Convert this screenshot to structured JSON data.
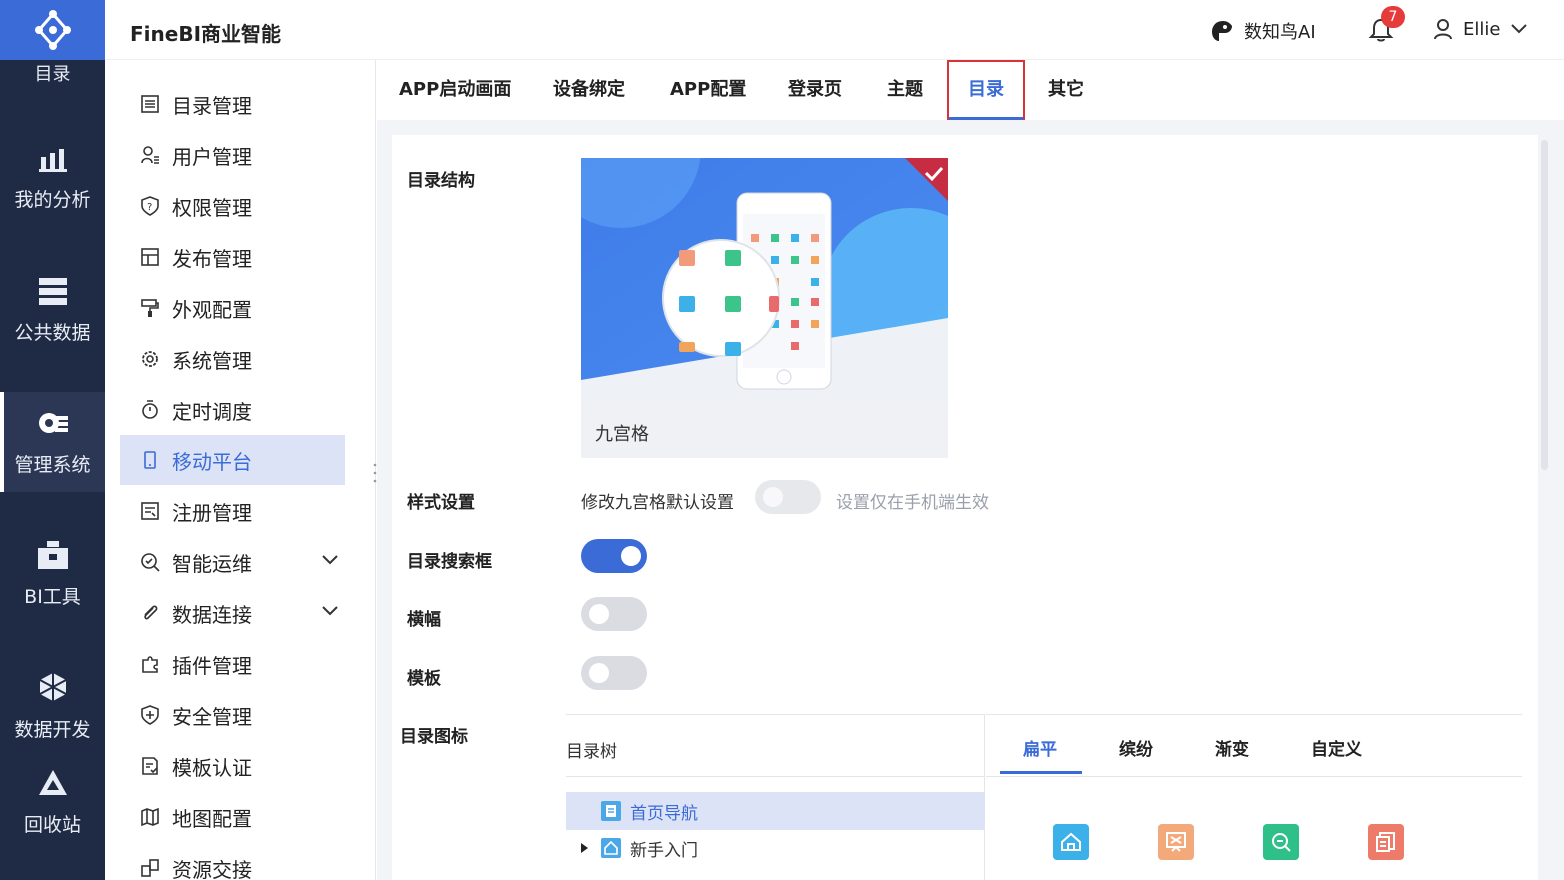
{
  "rail": {
    "top_label": "目录",
    "items": [
      {
        "label": "我的分析",
        "icon": "chart-icon"
      },
      {
        "label": "公共数据",
        "icon": "database-icon"
      },
      {
        "label": "管理系统",
        "icon": "gear-list-icon"
      },
      {
        "label": "BI工具",
        "icon": "toolbox-icon"
      },
      {
        "label": "数据开发",
        "icon": "cube-icon"
      },
      {
        "label": "回收站",
        "icon": "recycle-icon"
      }
    ]
  },
  "header": {
    "brand": "FineBI商业智能",
    "ai_label": "数知鸟AI",
    "notification_count": "7",
    "user_name": "Ellie"
  },
  "subnav": {
    "items": [
      {
        "label": "目录管理"
      },
      {
        "label": "用户管理"
      },
      {
        "label": "权限管理"
      },
      {
        "label": "发布管理"
      },
      {
        "label": "外观配置"
      },
      {
        "label": "系统管理"
      },
      {
        "label": "定时调度"
      },
      {
        "label": "移动平台"
      },
      {
        "label": "注册管理"
      },
      {
        "label": "智能运维"
      },
      {
        "label": "数据连接"
      },
      {
        "label": "插件管理"
      },
      {
        "label": "安全管理"
      },
      {
        "label": "模板认证"
      },
      {
        "label": "地图配置"
      },
      {
        "label": "资源交接"
      }
    ]
  },
  "tabs": [
    "APP启动画面",
    "设备绑定",
    "APP配置",
    "登录页",
    "主题",
    "目录",
    "其它"
  ],
  "form": {
    "structure_label": "目录结构",
    "card_caption": "九宫格",
    "style_label": "样式设置",
    "style_toggle_text": "修改九宫格默认设置",
    "style_hint": "设置仅在手机端生效",
    "search_label": "目录搜索框",
    "banner_label": "横幅",
    "template_label": "模板",
    "icon_label": "目录图标",
    "tree_header": "目录树",
    "tree_items": [
      "首页导航",
      "新手入门"
    ],
    "style_tabs": [
      "扁平",
      "缤纷",
      "渐变",
      "自定义"
    ]
  },
  "colors": {
    "accent": "#3b6bd6",
    "rail_bg": "#1f2a44",
    "active_tab_border": "#d8333a"
  }
}
